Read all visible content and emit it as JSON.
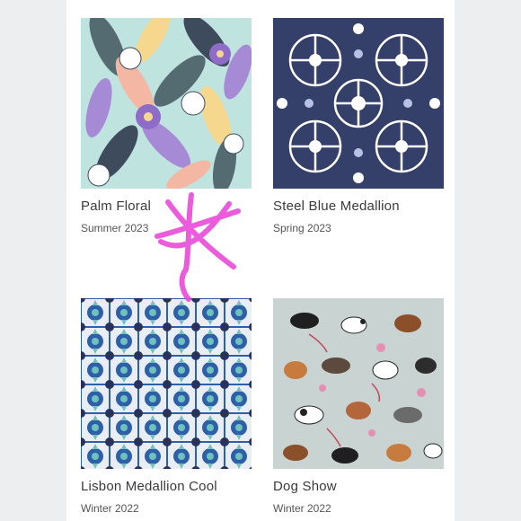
{
  "products": [
    {
      "name": "Palm Floral",
      "season": "Summer 2023",
      "pattern": "palm-floral"
    },
    {
      "name": "Steel Blue Medallion",
      "season": "Spring 2023",
      "pattern": "steel-blue-medallion"
    },
    {
      "name": "Lisbon Medallion Cool",
      "season": "Winter 2022",
      "pattern": "lisbon-medallion-cool"
    },
    {
      "name": "Dog Show",
      "season": "Winter 2022",
      "pattern": "dog-show"
    }
  ],
  "annotation": {
    "mark": "star-scribble",
    "color": "#e83fd6"
  },
  "colors": {
    "background": "#ffffff",
    "side_panel": "#eceef0",
    "navy": "#34406a",
    "floral_mint": "#bfe3df",
    "floral_lavender": "#a78ad6",
    "lisbon_blue": "#2f5fa8",
    "dogshow_gray": "#c9d3d1"
  }
}
